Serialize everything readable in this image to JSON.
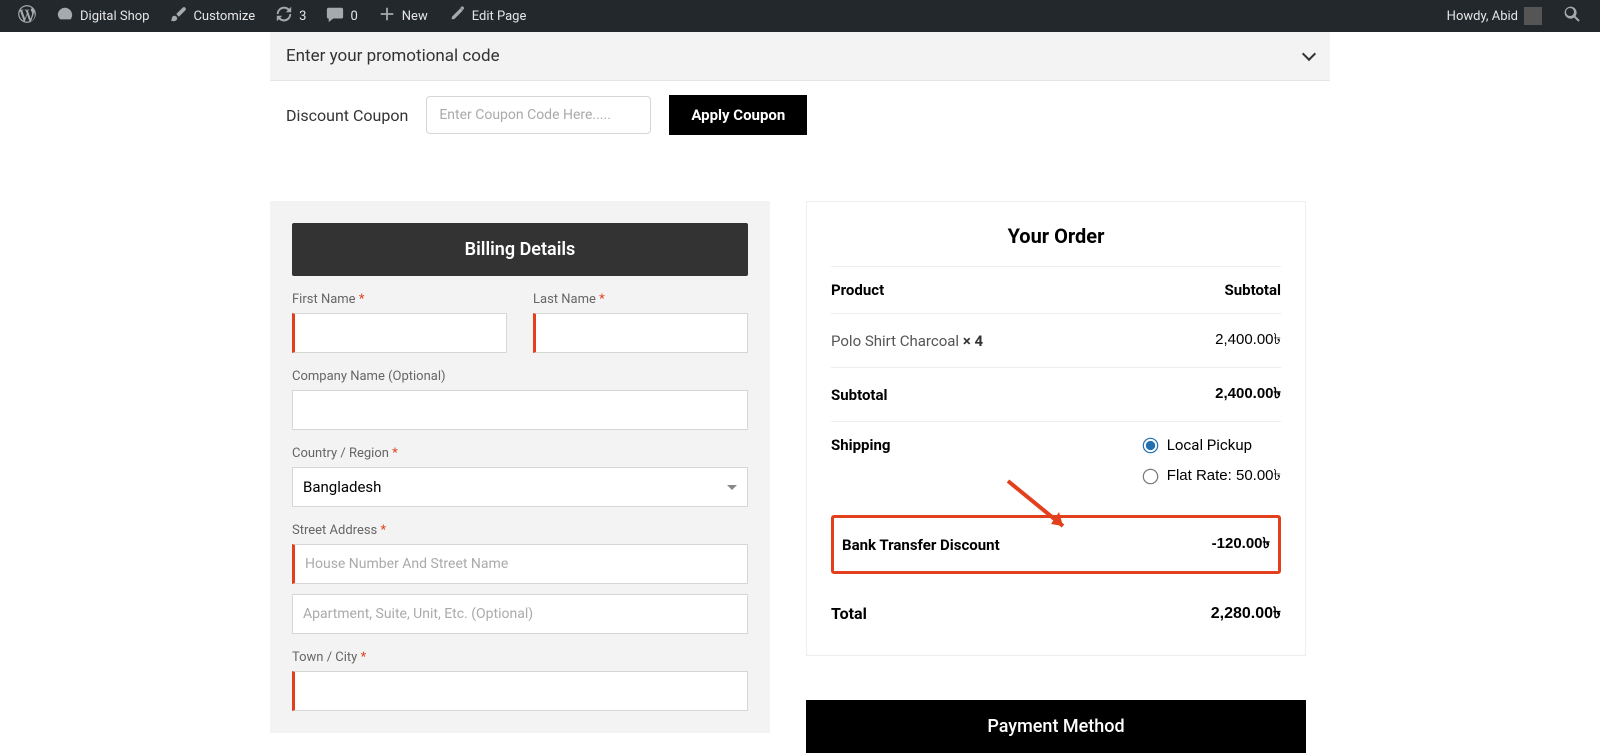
{
  "adminbar": {
    "site_name": "Digital Shop",
    "customize": "Customize",
    "updates_count": "3",
    "comments_count": "0",
    "new_label": "New",
    "edit_page": "Edit Page",
    "greeting": "Howdy, Abid"
  },
  "coupon": {
    "promo_header": "Enter your promotional code",
    "label": "Discount Coupon",
    "placeholder": "Enter Coupon Code Here.....",
    "apply": "Apply Coupon"
  },
  "billing": {
    "header": "Billing Details",
    "first_name": "First Name",
    "last_name": "Last Name",
    "company": "Company Name (Optional)",
    "country_label": "Country / Region",
    "country_value": "Bangladesh",
    "street_label": "Street Address",
    "street_placeholder": "House Number And Street Name",
    "apt_placeholder": "Apartment, Suite, Unit, Etc. (Optional)",
    "city_label": "Town / City"
  },
  "order": {
    "title": "Your Order",
    "col_product": "Product",
    "col_subtotal": "Subtotal",
    "product_name": "Polo Shirt Charcoal ",
    "product_qty": "× 4",
    "product_total": "2,400.00৳ ",
    "subtotal_label": "Subtotal",
    "subtotal_value": "2,400.00৳ ",
    "shipping_label": "Shipping",
    "ship_local": "Local Pickup",
    "ship_flat": "Flat Rate: 50.00৳ ",
    "discount_label": "Bank Transfer Discount",
    "discount_value": "-120.00৳ ",
    "total_label": "Total",
    "total_value": "2,280.00৳ "
  },
  "payment": {
    "header": "Payment Method"
  }
}
